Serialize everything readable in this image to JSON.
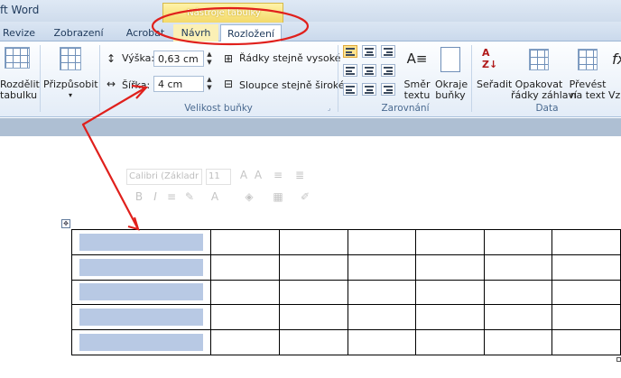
{
  "window": {
    "title": "ft Word"
  },
  "contextual_group": {
    "label": "Nástroje tabulky"
  },
  "tabs": [
    {
      "label": "Revize"
    },
    {
      "label": "Zobrazení"
    },
    {
      "label": "Acrobat"
    },
    {
      "label": "Návrh"
    },
    {
      "label": "Rozložení"
    }
  ],
  "ribbon": {
    "split_table": {
      "label_line1": "Rozdělit",
      "label_line2": "tabulku"
    },
    "autofit": {
      "label": "Přizpůsobit"
    },
    "height": {
      "label": "Výška:",
      "value": "0,63 cm"
    },
    "width": {
      "label": "Šířka:",
      "value": "4 cm"
    },
    "distribute_rows": {
      "label": "Řádky stejně vysoké"
    },
    "distribute_cols": {
      "label": "Sloupce stejně široké"
    },
    "cell_size_group": {
      "label": "Velikost buňky"
    },
    "text_direction": {
      "label_line1": "Směr",
      "label_line2": "textu"
    },
    "cell_margins": {
      "label_line1": "Okraje",
      "label_line2": "buňky"
    },
    "alignment_group": {
      "label": "Zarovnání"
    },
    "sort": {
      "label": "Seřadit"
    },
    "repeat_header": {
      "label_line1": "Opakovat",
      "label_line2": "řádky záhlaví"
    },
    "convert": {
      "label_line1": "Převést",
      "label_line2": "na text"
    },
    "formula": {
      "label_line1": "Vz"
    },
    "data_group": {
      "label": "Data"
    }
  },
  "mini_toolbar": {
    "font": "Calibri (Základr",
    "size": "11"
  },
  "table": {
    "rows": 5,
    "cols": 7,
    "selected_column": 0
  },
  "colors": {
    "annotation": "#e0201c",
    "selection": "#b8c9e4",
    "contextual_header": "#f3d96a"
  }
}
